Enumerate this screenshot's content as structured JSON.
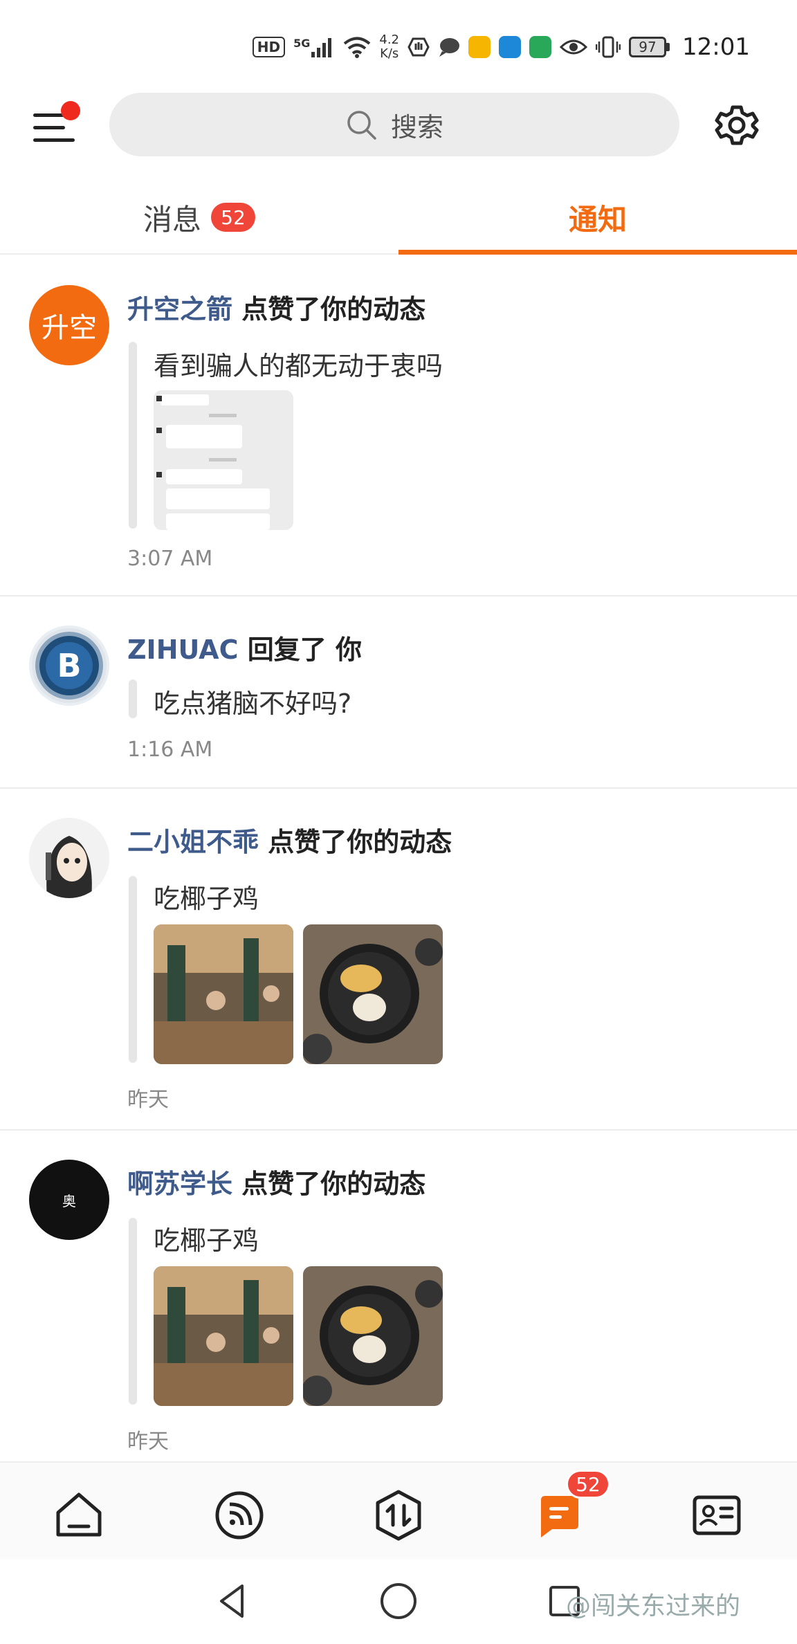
{
  "status_bar": {
    "hd": "HD",
    "network": "5G",
    "speed_value": "4.2",
    "speed_unit": "K/s",
    "battery": "97",
    "time": "12:01"
  },
  "top_bar": {
    "search_label": "搜索"
  },
  "tabs": [
    {
      "label": "消息",
      "badge": "52",
      "active": false
    },
    {
      "label": "通知",
      "active": true
    }
  ],
  "notifications": [
    {
      "user": "升空之箭",
      "action": "点赞了你的动态",
      "content": "看到骗人的都无动于衷吗",
      "time": "3:07 AM",
      "avatar_text": "升空"
    },
    {
      "user": "ZIHUAC",
      "action": "回复了 你",
      "content": "吃点猪脑不好吗?",
      "time": "1:16 AM"
    },
    {
      "user": "二小姐不乖",
      "action": "点赞了你的动态",
      "content": "吃椰子鸡",
      "time": "昨天"
    },
    {
      "user": "啊苏学长",
      "action": "点赞了你的动态",
      "content": "吃椰子鸡",
      "time": "昨天",
      "avatar_text": "奥"
    }
  ],
  "bottom_nav": {
    "items": [
      "home-icon",
      "feed-icon",
      "trade-icon",
      "message-icon",
      "profile-card-icon"
    ],
    "message_badge": "52"
  },
  "watermark": "@闯关东过来的",
  "colors": {
    "accent": "#f26b11",
    "badge": "#f0463a",
    "username": "#3f5b8c"
  }
}
